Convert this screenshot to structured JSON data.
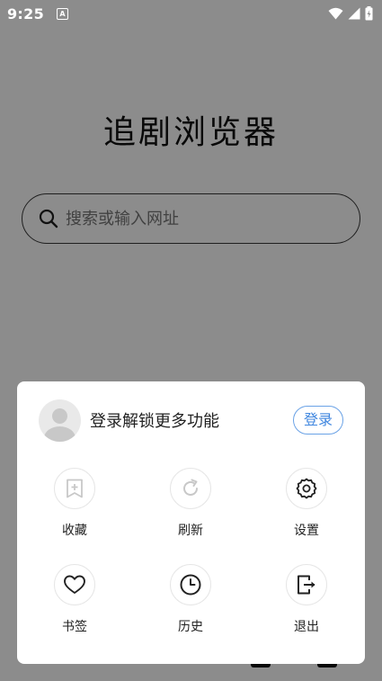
{
  "status_bar": {
    "time": "9:25",
    "notification_glyph": "A",
    "icons": [
      "notification-icon",
      "wifi-icon",
      "signal-icon",
      "battery-icon"
    ]
  },
  "page": {
    "title": "追剧浏览器",
    "search": {
      "placeholder": "搜索或输入网址",
      "value": ""
    }
  },
  "menu": {
    "login_prompt": "登录解锁更多功能",
    "login_button": "登录",
    "items": [
      {
        "label": "收藏",
        "icon": "bookmark-add-icon",
        "enabled": false
      },
      {
        "label": "刷新",
        "icon": "refresh-icon",
        "enabled": false
      },
      {
        "label": "设置",
        "icon": "gear-icon",
        "enabled": true
      },
      {
        "label": "书签",
        "icon": "heart-icon",
        "enabled": true
      },
      {
        "label": "历史",
        "icon": "clock-icon",
        "enabled": true
      },
      {
        "label": "退出",
        "icon": "exit-icon",
        "enabled": true
      }
    ]
  },
  "colors": {
    "accent": "#3f86df",
    "overlay": "rgba(0,0,0,0.45)",
    "disabled_icon": "#c8c8c8",
    "icon": "#222222"
  }
}
